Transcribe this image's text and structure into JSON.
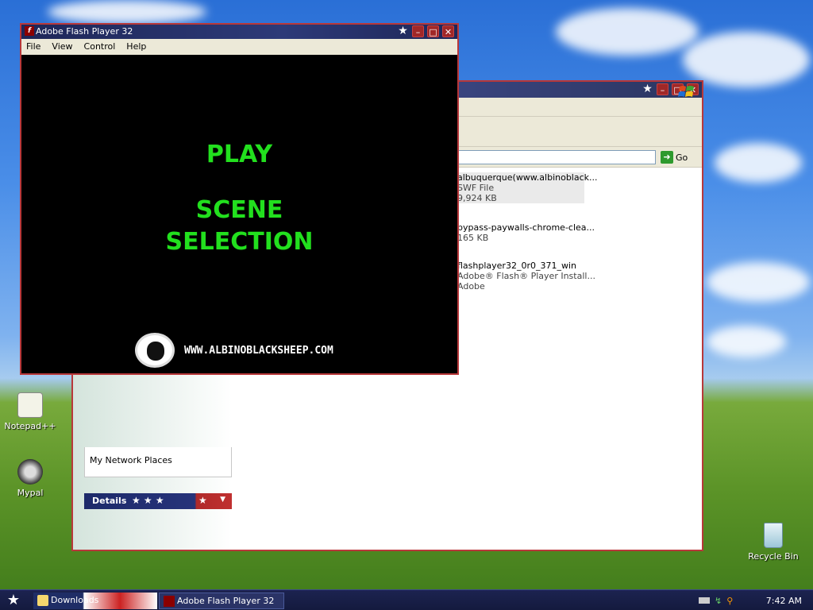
{
  "flash": {
    "title": "Adobe Flash Player 32",
    "menu": [
      "File",
      "View",
      "Control",
      "Help"
    ],
    "stage": {
      "play": "PLAY",
      "scene_line1": "SCENE",
      "scene_line2": "SELECTION",
      "site": "WWW.ALBINOBLACKSHEEP.COM",
      "accent_color": "#22e01e"
    }
  },
  "explorer": {
    "go_label": "Go",
    "files": [
      {
        "name": "albuquerque(www.albinoblack...",
        "type": "SWF File",
        "size": "9,924 KB"
      },
      {
        "name": "bypass-paywalls-chrome-clea...",
        "size": "165 KB"
      },
      {
        "name": "flashplayer32_0r0_371_win",
        "desc": "Adobe® Flash® Player Install...",
        "company": "Adobe"
      }
    ],
    "nav_item": "My Network Places",
    "details_label": "Details"
  },
  "desktop": {
    "icons": [
      {
        "label": "Notepad++"
      },
      {
        "label": "Mypal"
      },
      {
        "label": "Recycle Bin"
      }
    ]
  },
  "taskbar": {
    "tasks": [
      "Downloads",
      "Adobe Flash Player 32"
    ],
    "clock": "7:42 AM"
  }
}
